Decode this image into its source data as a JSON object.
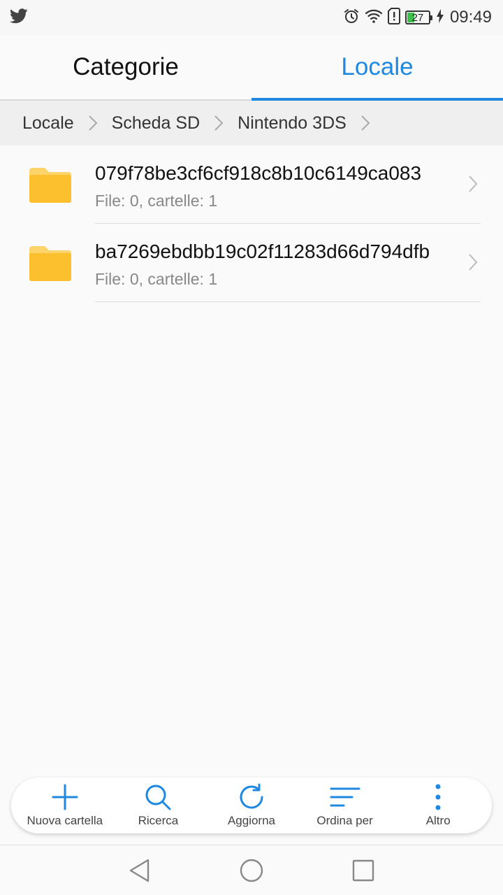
{
  "status_bar": {
    "app_icon": "twitter-bird-icon",
    "icons": [
      "alarm-icon",
      "wifi-icon",
      "sim-alert-icon"
    ],
    "battery_level": "27",
    "charging": true,
    "time": "09:49"
  },
  "tabs": [
    {
      "label": "Categorie",
      "active": false
    },
    {
      "label": "Locale",
      "active": true
    }
  ],
  "accent_color": "#1f88e0",
  "breadcrumb": [
    "Locale",
    "Scheda SD",
    "Nintendo 3DS"
  ],
  "files": [
    {
      "name": "079f78be3cf6cf918c8b10c6149ca083",
      "meta": "File: 0, cartelle: 1",
      "icon": "folder-icon"
    },
    {
      "name": "ba7269ebdbb19c02f11283d66d794dfb",
      "meta": "File: 0, cartelle: 1",
      "icon": "folder-icon"
    }
  ],
  "toolbar": {
    "new_folder": "Nuova cartella",
    "search": "Ricerca",
    "refresh": "Aggiorna",
    "sort": "Ordina per",
    "more": "Altro"
  },
  "navbar": [
    "back-icon",
    "home-icon",
    "recents-icon"
  ]
}
